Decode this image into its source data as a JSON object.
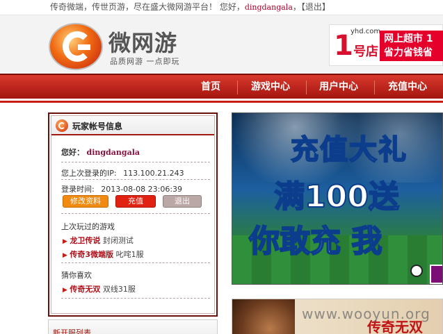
{
  "topbar": {
    "intro": "传奇微端，传世页游，尽在盛大微网游平台！ 您好，",
    "username": "dingdangala",
    "logout": "【退出】"
  },
  "header": {
    "logo_text": "微网游",
    "logo_sub": "品质网游 一点即玩",
    "ad": {
      "num": "1",
      "domain": "yhd.com",
      "store": "号店",
      "line1": "网上超市 1",
      "line2": "省力省钱省"
    }
  },
  "nav": {
    "items": [
      "首页",
      "游戏中心",
      "用户中心",
      "充值中心"
    ]
  },
  "panel": {
    "title": "玩家帐号信息",
    "hello_label": "您好：",
    "username": "dingdangala",
    "last_ip_label": "您上次登录的IP:",
    "last_ip": "113.100.21.243",
    "login_time_label": "登录时间:",
    "login_time": "2013-08-08 23:06:39",
    "buttons": {
      "edit": "修改资料",
      "pay": "充值",
      "logout": "退出"
    },
    "played_title": "上次玩过的游戏",
    "played": [
      {
        "name": "龙卫传说",
        "server": "封闭测试"
      },
      {
        "name": "传奇3微端版",
        "server": "叱咤1服"
      }
    ],
    "like_title": "猜你喜欢",
    "like": [
      {
        "name": "传奇无双",
        "server": "双线31服"
      }
    ]
  },
  "panel2": {
    "title": "新开服列表"
  },
  "banner": {
    "line1": "充值大礼",
    "line2": "满100送",
    "line3": "你敢充 我"
  },
  "banner2": {
    "title": "传奇无双"
  },
  "watermark": "www.wooyun.org"
}
